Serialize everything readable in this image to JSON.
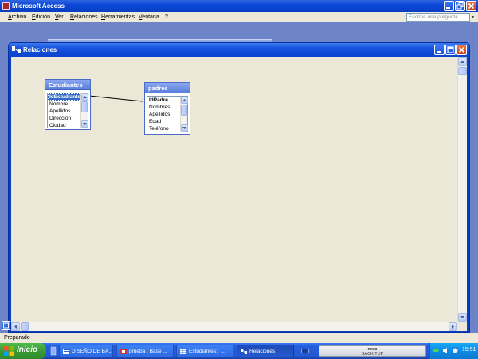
{
  "app": {
    "title": "Microsoft Access"
  },
  "menu": {
    "items": [
      "Archivo",
      "Edición",
      "Ver",
      "Relaciones",
      "Herramientas",
      "Ventana",
      "?"
    ],
    "help_placeholder": "Escriba una pregunta"
  },
  "window": {
    "title": "Relaciones"
  },
  "tables": {
    "estudiantes": {
      "name": "Estudiantes",
      "fields": [
        "IdEstudiante",
        "Nombre",
        "Apellidos",
        "Dirección",
        "Ciudad"
      ]
    },
    "padres": {
      "name": "padres",
      "fields": [
        "IdPadre",
        "Nombres",
        "Apellidos",
        "Edad",
        "Teléfono"
      ]
    }
  },
  "status": {
    "text": "Preparado"
  },
  "taskbar": {
    "start_label": "Inicio",
    "tasks": [
      {
        "label": "DISEÑO DE BA...",
        "icon": "word-icon"
      },
      {
        "label": "prueba : Base ...",
        "icon": "access-icon"
      },
      {
        "label": "Estudiantes : ...",
        "icon": "table-icon"
      },
      {
        "label": "Relaciones",
        "icon": "relationships-icon"
      }
    ],
    "nero_line1": "nero",
    "nero_line2": "BACKITUP",
    "clock": "15:51"
  },
  "colors": {
    "xp_blue": "#0a46d6",
    "workspace": "#6d84c8",
    "canvas": "#ebe8d7",
    "start_green": "#3a9b37",
    "selection": "#316ac5"
  }
}
